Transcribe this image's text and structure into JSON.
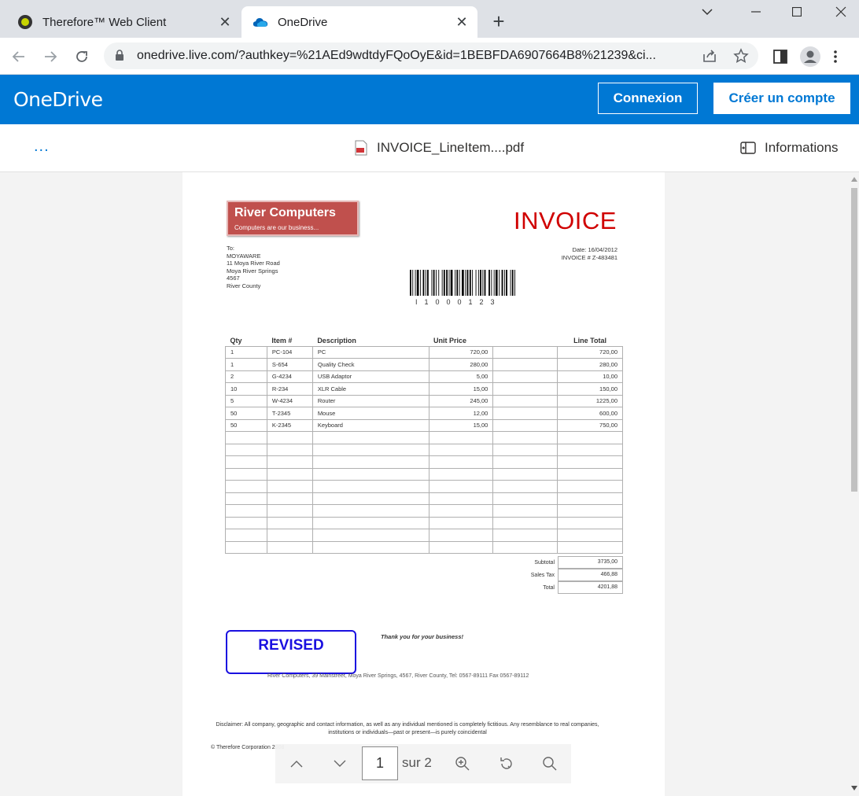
{
  "browser": {
    "tabs": [
      {
        "title": "Therefore™ Web Client",
        "active": false
      },
      {
        "title": "OneDrive",
        "active": true
      }
    ],
    "url": "onedrive.live.com/?authkey=%21AEd9wdtdyFQoOyE&id=1BEBFDA6907664B8%21239&ci..."
  },
  "onedrive": {
    "brand": "OneDrive",
    "login_label": "Connexion",
    "signup_label": "Créer un compte",
    "more_label": "...",
    "file_name": "INVOICE_LineItem....pdf",
    "info_label": "Informations"
  },
  "invoice": {
    "company": "River Computers",
    "tagline": "Computers are our business...",
    "title": "INVOICE",
    "to_label": "To:",
    "to_lines": [
      "MOYAWARE",
      "11 Moya River Road",
      "Moya River Springs",
      "4567",
      "River County"
    ],
    "date_line": "Date: 16/04/2012",
    "invoice_no_line": "INVOICE # Z-483481",
    "barcode_number": "I1000123",
    "columns": [
      "Qty",
      "Item #",
      "Description",
      "Unit Price",
      "Line Total"
    ],
    "rows": [
      {
        "qty": "1",
        "item": "PC-104",
        "desc": "PC",
        "price": "720,00",
        "total": "720,00"
      },
      {
        "qty": "1",
        "item": "S-654",
        "desc": "Quality Check",
        "price": "280,00",
        "total": "280,00"
      },
      {
        "qty": "2",
        "item": "G-4234",
        "desc": "USB Adaptor",
        "price": "5,00",
        "total": "10,00"
      },
      {
        "qty": "10",
        "item": "R-234",
        "desc": "XLR Cable",
        "price": "15,00",
        "total": "150,00"
      },
      {
        "qty": "5",
        "item": "W-4234",
        "desc": "Router",
        "price": "245,00",
        "total": "1225,00"
      },
      {
        "qty": "50",
        "item": "T-2345",
        "desc": "Mouse",
        "price": "12,00",
        "total": "600,00"
      },
      {
        "qty": "50",
        "item": "K-2345",
        "desc": "Keyboard",
        "price": "15,00",
        "total": "750,00"
      }
    ],
    "empty_rows": 10,
    "subtotal_label": "Subtotal",
    "subtotal": "3735,00",
    "tax_label": "Sales Tax",
    "tax": "466,88",
    "total_label": "Total",
    "total": "4201,88",
    "stamp": "REVISED",
    "thanks": "Thank you for your business!",
    "footer_address": "River Computers, 39 Mainstreet, Moya River Springs, 4567, River County,  Tel: 0567-89111  Fax 0567-89112",
    "disclaimer": "Disclaimer: All company, geographic and contact information, as well as any individual mentioned is completely fictitious.  Any resemblance to real companies, institutions or individuals—past or present—is purely coincidental",
    "copyright": "© Therefore Corporation 2008"
  },
  "pager": {
    "current_page": "1",
    "of_label": "sur 2"
  },
  "colors": {
    "onedrive_blue": "#0078d4",
    "invoice_red": "#d00000",
    "stamp_blue": "#1a10e0",
    "logo_red": "#c0504d"
  }
}
